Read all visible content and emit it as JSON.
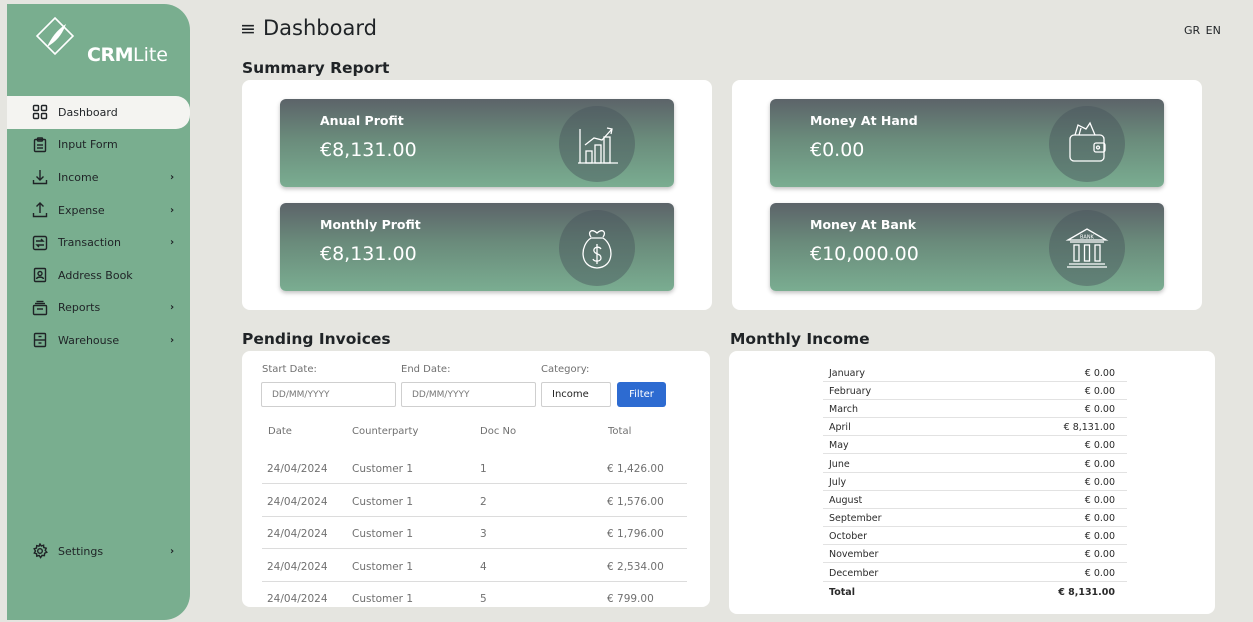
{
  "app": {
    "brand_bold": "CRM",
    "brand_light": "Lite"
  },
  "header": {
    "title": "Dashboard",
    "lang_gr": "GR",
    "lang_en": "EN"
  },
  "sidebar": {
    "items": [
      {
        "label": "Dashboard",
        "icon": "grid-icon",
        "chevron": ""
      },
      {
        "label": "Input Form",
        "icon": "clipboard-icon",
        "chevron": ""
      },
      {
        "label": "Income",
        "icon": "arrow-down-icon",
        "chevron": "›"
      },
      {
        "label": "Expense",
        "icon": "arrow-up-icon",
        "chevron": "›"
      },
      {
        "label": "Transaction",
        "icon": "transfer-icon",
        "chevron": "›"
      },
      {
        "label": "Address Book",
        "icon": "address-book-icon",
        "chevron": ""
      },
      {
        "label": "Reports",
        "icon": "reports-icon",
        "chevron": "›"
      },
      {
        "label": "Warehouse",
        "icon": "warehouse-icon",
        "chevron": "›"
      }
    ],
    "settings": {
      "label": "Settings",
      "chevron": "›"
    }
  },
  "summary": {
    "title": "Summary Report",
    "annual_profit": {
      "label": "Anual Profit",
      "value": "€8,131.00"
    },
    "monthly_profit": {
      "label": "Monthly Profit",
      "value": "€8,131.00"
    },
    "money_at_hand": {
      "label": "Money At Hand",
      "value": "€0.00"
    },
    "money_at_bank": {
      "label": "Money At Bank",
      "value": "€10,000.00",
      "bank_sign": "BANK"
    }
  },
  "invoices": {
    "title": "Pending Invoices",
    "start_label": "Start Date:",
    "end_label": "End Date:",
    "category_label": "Category:",
    "start_placeholder": "DD/MM/YYYY",
    "end_placeholder": "DD/MM/YYYY",
    "category_value": "Income",
    "filter_label": "Filter",
    "columns": [
      "Date",
      "Counterparty",
      "Doc No",
      "Total"
    ],
    "rows": [
      {
        "date": "24/04/2024",
        "party": "Customer 1",
        "doc": "1",
        "total": "€ 1,426.00"
      },
      {
        "date": "24/04/2024",
        "party": "Customer 1",
        "doc": "2",
        "total": "€ 1,576.00"
      },
      {
        "date": "24/04/2024",
        "party": "Customer 1",
        "doc": "3",
        "total": "€ 1,796.00"
      },
      {
        "date": "24/04/2024",
        "party": "Customer 1",
        "doc": "4",
        "total": "€ 2,534.00"
      },
      {
        "date": "24/04/2024",
        "party": "Customer 1",
        "doc": "5",
        "total": "€ 799.00"
      }
    ]
  },
  "monthly_income": {
    "title": "Monthly Income",
    "rows": [
      {
        "month": "January",
        "value": "€ 0.00"
      },
      {
        "month": "February",
        "value": "€ 0.00"
      },
      {
        "month": "March",
        "value": "€ 0.00"
      },
      {
        "month": "April",
        "value": "€ 8,131.00"
      },
      {
        "month": "May",
        "value": "€ 0.00"
      },
      {
        "month": "June",
        "value": "€ 0.00"
      },
      {
        "month": "July",
        "value": "€ 0.00"
      },
      {
        "month": "August",
        "value": "€ 0.00"
      },
      {
        "month": "September",
        "value": "€ 0.00"
      },
      {
        "month": "October",
        "value": "€ 0.00"
      },
      {
        "month": "November",
        "value": "€ 0.00"
      },
      {
        "month": "December",
        "value": "€ 0.00"
      }
    ],
    "total_label": "Total",
    "total_value": "€ 8,131.00"
  }
}
